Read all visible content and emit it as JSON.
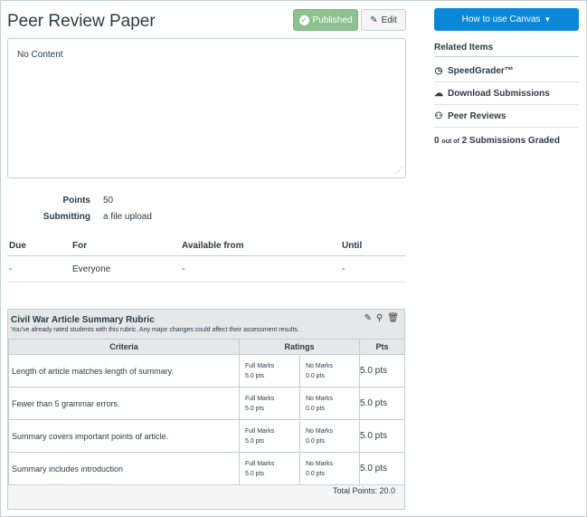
{
  "header": {
    "title": "Peer Review Paper",
    "published_label": "Published",
    "edit_label": "Edit"
  },
  "content": {
    "text": "No Content"
  },
  "details": {
    "points_label": "Points",
    "points_value": "50",
    "submitting_label": "Submitting",
    "submitting_value": "a file upload"
  },
  "due_table": {
    "headers": [
      "Due",
      "For",
      "Available from",
      "Until"
    ],
    "row": [
      "-",
      "Everyone",
      "-",
      "-"
    ]
  },
  "rubric": {
    "title": "Civil War Article Summary Rubric",
    "warning": "You've already rated students with this rubric. Any major changes could affect their assessment results.",
    "columns": [
      "Criteria",
      "Ratings",
      "Pts"
    ],
    "rows": [
      {
        "criteria": "Length of article matches length of summary.",
        "r1_label": "Full Marks",
        "r1_pts": "5.0 pts",
        "r2_label": "No Marks",
        "r2_pts": "0.0 pts",
        "pts": "5.0 pts"
      },
      {
        "criteria": "Fewer than 5 grammar errors.",
        "r1_label": "Full Marks",
        "r1_pts": "5.0 pts",
        "r2_label": "No Marks",
        "r2_pts": "0.0 pts",
        "pts": "5.0 pts"
      },
      {
        "criteria": "Summary covers important points of article.",
        "r1_label": "Full Marks",
        "r1_pts": "5.0 pts",
        "r2_label": "No Marks",
        "r2_pts": "0.0 pts",
        "pts": "5.0 pts"
      },
      {
        "criteria": "Summary includes introduction",
        "r1_label": "Full Marks",
        "r1_pts": "5.0 pts",
        "r2_label": "No Marks",
        "r2_pts": "0.0 pts",
        "pts": "5.0 pts"
      }
    ],
    "total": "Total Points: 20.0"
  },
  "sidebar": {
    "how_to_label": "How to use Canvas",
    "related_title": "Related Items",
    "items": [
      {
        "label": "SpeedGrader™",
        "icon": "speedgrader-icon"
      },
      {
        "label": "Download Submissions",
        "icon": "download-icon"
      },
      {
        "label": "Peer Reviews",
        "icon": "peer-review-icon"
      }
    ],
    "graded_count": "0",
    "graded_out_of": "out of",
    "graded_text": "2 Submissions Graded"
  },
  "colors": {
    "published": "#8cc190",
    "primary": "#0a87d8",
    "text": "#2d3b45"
  }
}
